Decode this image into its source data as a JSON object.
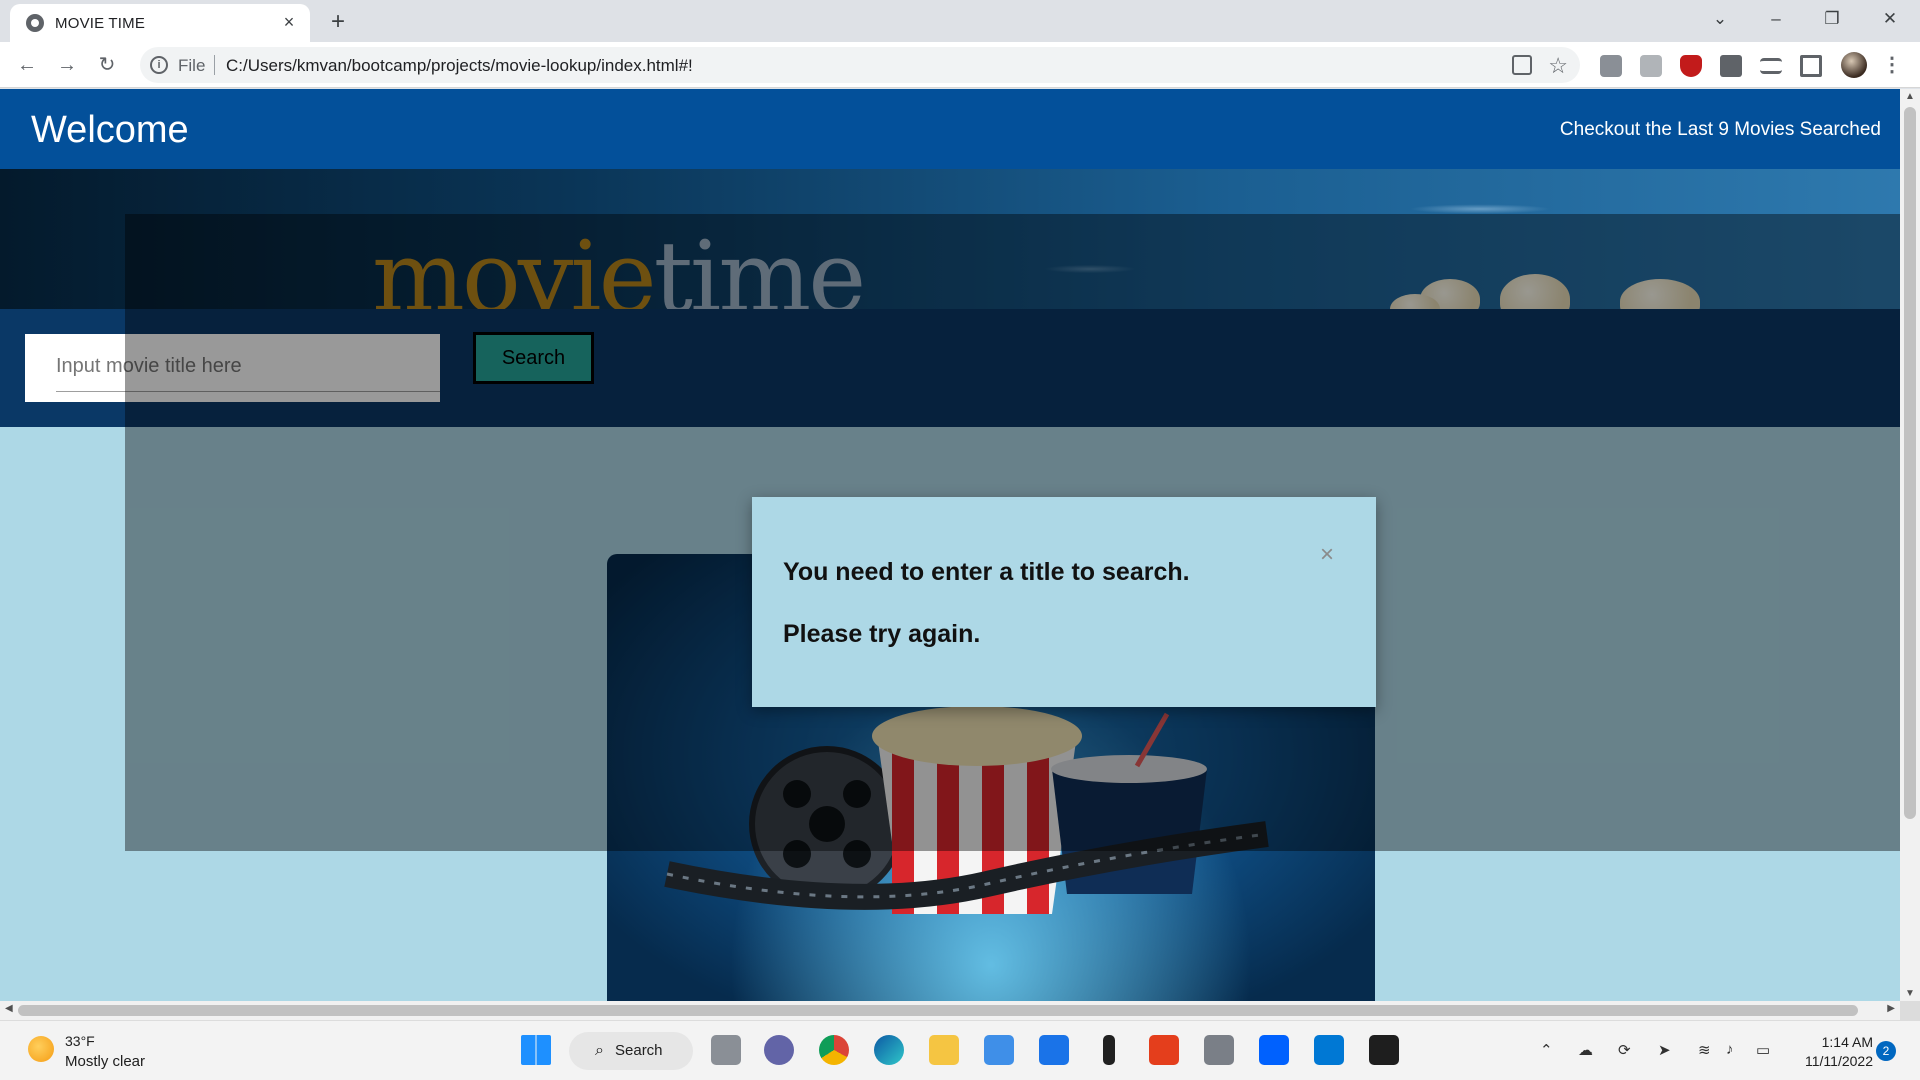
{
  "browser": {
    "tab_title": "MOVIE TIME",
    "tab_close": "×",
    "new_tab": "+",
    "address_scheme": "File",
    "address_url": "C:/Users/kmvan/bootcamp/projects/movie-lookup/index.html#!"
  },
  "page": {
    "brand": "Welcome",
    "recent_link": "Checkout the Last 9 Movies Searched",
    "logo_part1": "movie",
    "logo_part2": "time",
    "search_placeholder": "Input movie title here",
    "search_button": "Search"
  },
  "modal": {
    "line1": "You need to enter a title to search.",
    "line2": "Please try again.",
    "close": "×"
  },
  "taskbar": {
    "temperature": "33°F",
    "condition": "Mostly clear",
    "search_label": "Search",
    "time": "1:14 AM",
    "date": "11/11/2022",
    "notification_count": "2"
  }
}
